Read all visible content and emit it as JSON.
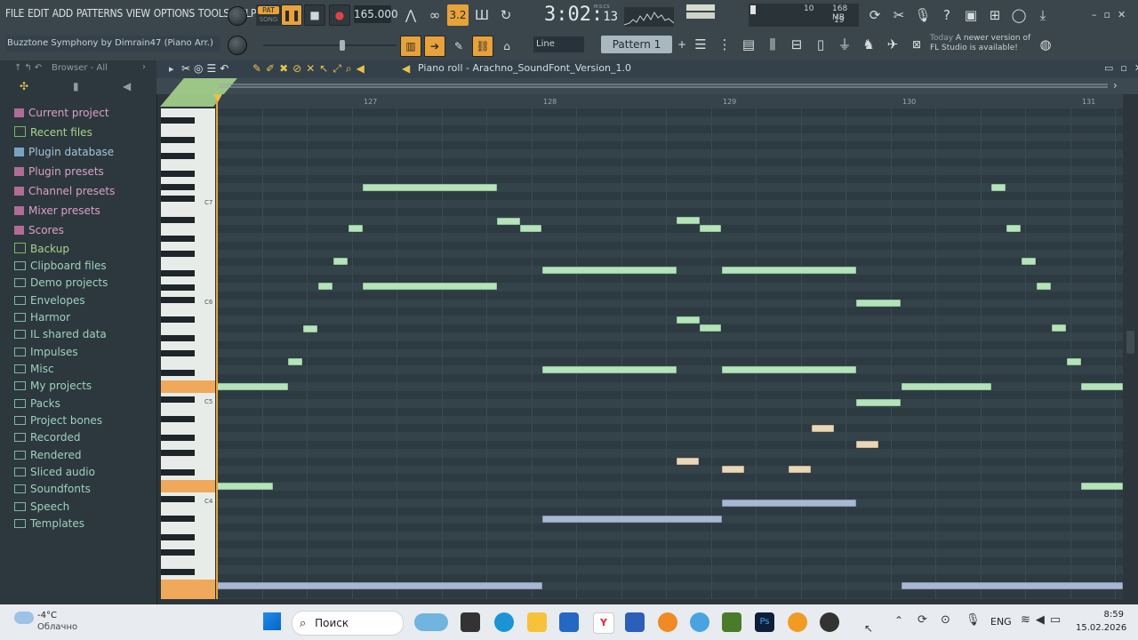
{
  "menu": [
    "FILE",
    "EDIT",
    "ADD",
    "PATTERNS",
    "VIEW",
    "OPTIONS",
    "TOOLS",
    "HELP"
  ],
  "transport": {
    "pat_label": "PAT",
    "song_label": "SONG",
    "bpm": "165.000",
    "time": "3:02",
    "time_small": "13",
    "time_unit": "M:S:CS",
    "snap": "Line",
    "pattern": "Pattern 1",
    "cpu": "10",
    "mem": "168 MB",
    "poly": "19"
  },
  "hint": "Buzztone Symphony by Dimrain47 (Piano Arr.)",
  "news": {
    "prefix": "Today",
    "text": "A newer version of FL Studio is available!"
  },
  "browser": {
    "header": "Browser - All",
    "items": [
      {
        "label": "Current project",
        "style": "pink"
      },
      {
        "label": "Recent files",
        "style": "green"
      },
      {
        "label": "Plugin database",
        "style": "blue"
      },
      {
        "label": "Plugin presets",
        "style": "pink"
      },
      {
        "label": "Channel presets",
        "style": "pink"
      },
      {
        "label": "Mixer presets",
        "style": "pink"
      },
      {
        "label": "Scores",
        "style": "pink"
      },
      {
        "label": "Backup",
        "style": "green"
      },
      {
        "label": "Clipboard files",
        "style": "plain"
      },
      {
        "label": "Demo projects",
        "style": "plain"
      },
      {
        "label": "Envelopes",
        "style": "plain"
      },
      {
        "label": "Harmor",
        "style": "plain"
      },
      {
        "label": "IL shared data",
        "style": "plain"
      },
      {
        "label": "Impulses",
        "style": "plain"
      },
      {
        "label": "Misc",
        "style": "plain"
      },
      {
        "label": "My projects",
        "style": "plain"
      },
      {
        "label": "Packs",
        "style": "plain"
      },
      {
        "label": "Project bones",
        "style": "plain"
      },
      {
        "label": "Recorded",
        "style": "plain"
      },
      {
        "label": "Rendered",
        "style": "plain"
      },
      {
        "label": "Sliced audio",
        "style": "plain"
      },
      {
        "label": "Soundfonts",
        "style": "plain"
      },
      {
        "label": "Speech",
        "style": "plain"
      },
      {
        "label": "Templates",
        "style": "plain"
      }
    ]
  },
  "pianoroll": {
    "title": "Piano roll - Arachno_SoundFont_Version_1.0",
    "bars": [
      "127",
      "128",
      "129",
      "130",
      "131"
    ],
    "octaves": [
      "C7",
      "C6",
      "C5",
      "C4"
    ]
  },
  "taskbar": {
    "weather_temp": "-4°C",
    "weather_desc": "Облачно",
    "search_placeholder": "Поиск",
    "lang": "ENG",
    "clock_time": "8:59",
    "clock_date": "15.02.2026"
  },
  "colors": {
    "green_note": "#b6e3b9",
    "beige_note": "#e8d7b9",
    "blue_note": "#aab7d2",
    "accent": "#e8a23a"
  }
}
